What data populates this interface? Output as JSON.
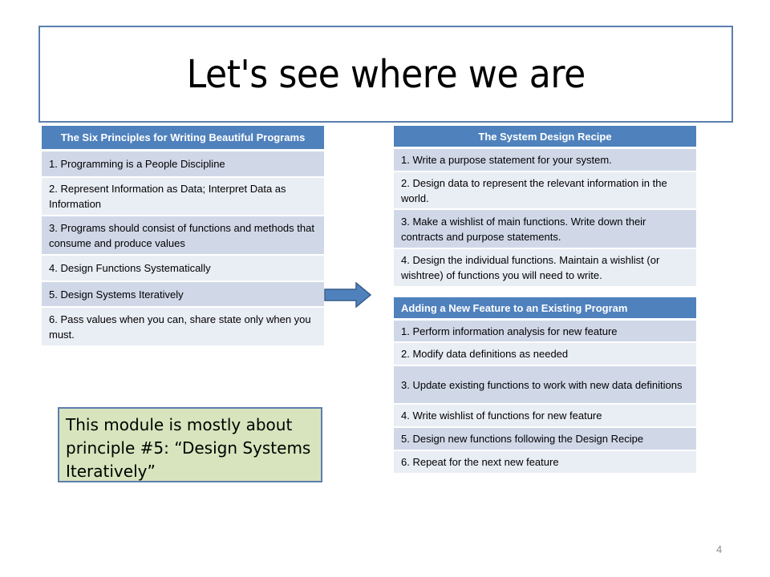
{
  "slide": {
    "title": "Let's see where we are",
    "page_number": "4"
  },
  "principles": {
    "header": "The Six Principles for Writing Beautiful Programs",
    "items": [
      "1. Programming  is a People Discipline",
      "2. Represent Information  as Data; Interpret Data as Information",
      "3. Programs should consist of functions and methods that consume and produce values",
      "4. Design Functions Systematically",
      "5. Design Systems Iteratively",
      "6. Pass values when you can, share state only when you must."
    ]
  },
  "recipe": {
    "header": "The System Design Recipe",
    "items": [
      "1. Write a purpose statement for your system.",
      "2. Design data to represent the relevant information in the world.",
      "3. Make a wishlist of main functions.  Write down their contracts and purpose statements.",
      "4. Design the individual functions. Maintain a wishlist (or wishtree) of functions you will need to write."
    ]
  },
  "feature": {
    "header": "Adding a New Feature to an Existing Program",
    "items": [
      "1. Perform information analysis for new feature",
      "2. Modify data definitions as needed",
      "3. Update existing functions to work with new data definitions",
      "4. Write wishlist of functions for new feature",
      "5. Design new functions following the Design Recipe",
      "6. Repeat for the next new feature"
    ]
  },
  "note": {
    "text": "This module is mostly about principle #5:  “Design Systems Iteratively”"
  },
  "icons": {
    "arrow": "right-arrow-icon"
  },
  "colors": {
    "header_blue": "#4f81bd",
    "row_dark": "#d0d8e8",
    "row_light": "#e9edf4",
    "border_blue": "#5b7fae",
    "note_green": "#d7e4bd"
  }
}
